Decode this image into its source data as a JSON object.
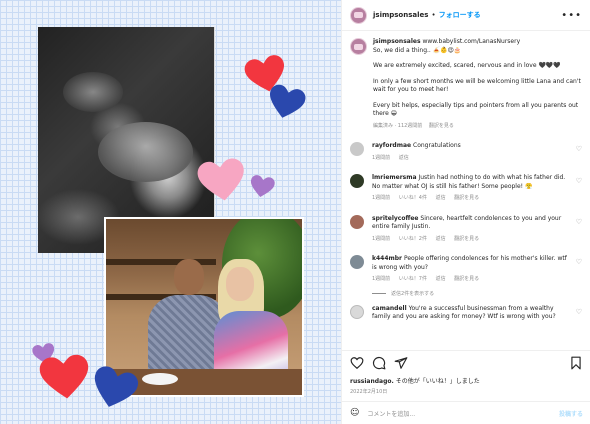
{
  "header": {
    "username": "jsimpsonsales",
    "separator": "•",
    "follow_label": "フォローする",
    "more": "•••"
  },
  "caption": {
    "username": "jsimpsonsales",
    "line1": "www.babylist.com/LanasNursery",
    "line2": "So, we did a thing.. 🍝👶😍🎂",
    "para2": "We are extremely excited, scared, nervous and in love 🖤🖤🖤",
    "para3": "In only a few short months we will be welcoming little Lana and can't wait for you to meet her!",
    "para4": "Every bit helps, especially tips and pointers from all you parents out there 😁",
    "meta_edited": "編集済み · 112週間前",
    "meta_translate": "翻訳を見る"
  },
  "comments": [
    {
      "username": "rayfordmae",
      "text": "Congratulations",
      "time": "1週間前",
      "reply": "返信",
      "likes": "",
      "translate": "",
      "avatar_color": "#c9c9c9"
    },
    {
      "username": "lmriemersma",
      "text": "Justin had nothing to do with what his father did. No matter what OJ is still his father! Some people! 😤",
      "time": "1週間前",
      "likes": "いいね！4件",
      "reply": "返信",
      "translate": "翻訳を見る",
      "avatar_color": "#2f3a26"
    },
    {
      "username": "spritelycoffee",
      "text": "Sincere, heartfelt condolences to you and your entire family Justin.",
      "time": "1週間前",
      "likes": "いいね！2件",
      "reply": "返信",
      "translate": "翻訳を見る",
      "avatar_color": "#a36a5a"
    },
    {
      "username": "k444mbr",
      "text": "People offering condolences for his mother's killer. wtf is wrong with you?",
      "time": "1週間前",
      "likes": "いいね！7件",
      "reply": "返信",
      "translate": "翻訳を見る",
      "avatar_color": "#7e8b95"
    },
    {
      "username": "camandell",
      "text": "You're a successful businessman from a wealthy family and you are asking for money? Wtf is wrong with you?",
      "time": "",
      "likes": "",
      "reply": "",
      "translate": "",
      "avatar_color": "#d9d9d9"
    }
  ],
  "replies_toggle": "返信2件を表示する",
  "actions": {
    "icons": [
      "heart-icon",
      "comment-icon",
      "share-icon",
      "bookmark-icon"
    ],
    "likes_user": "russiandago.",
    "likes_rest": "その他が「いいね！」しました",
    "date": "2022年2月10日"
  },
  "add_comment": {
    "emoji": "☺",
    "placeholder": "コメントを追加...",
    "post_label": "投稿する"
  },
  "colors": {
    "follow": "#0095f6",
    "heart_red": "#f2363f",
    "heart_blue": "#2a48ad",
    "heart_pink": "#f7a6c2",
    "heart_purple": "#a776c9"
  }
}
